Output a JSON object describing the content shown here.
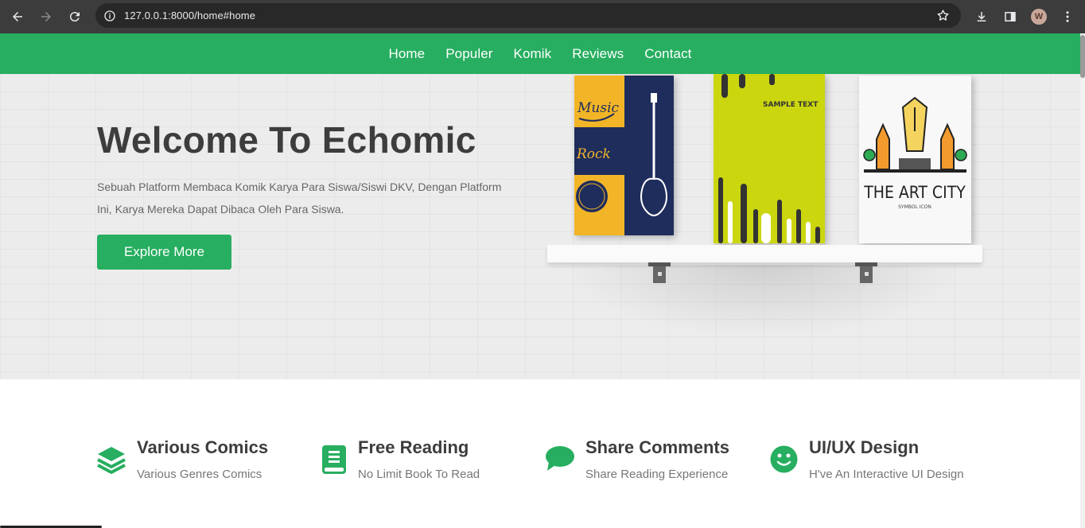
{
  "browser": {
    "url": "127.0.0.1:8000/home#home",
    "profile_initial": "W",
    "icons": [
      "back-icon",
      "forward-icon",
      "reload-icon",
      "info-icon",
      "star-icon",
      "download-icon",
      "side-panel-icon",
      "menu-dots-icon"
    ]
  },
  "navbar": {
    "links": [
      "Home",
      "Populer",
      "Komik",
      "Reviews",
      "Contact"
    ]
  },
  "hero": {
    "title": "Welcome To Echomic",
    "description": "Sebuah Platform Membaca Komik Karya Para Siswa/Siswi DKV, Dengan Platform Ini, Karya Mereka Dapat Dibaca Oleh Para Siswa.",
    "button": "Explore More",
    "books": [
      {
        "name": "music-rock-book",
        "texts": [
          "Music",
          "Rock"
        ]
      },
      {
        "name": "sample-text-book",
        "texts": [
          "SAMPLE TEXT"
        ]
      },
      {
        "name": "art-city-book",
        "texts": [
          "THE ART CITY",
          "SYMBOL ICON"
        ]
      }
    ]
  },
  "features": [
    {
      "icon": "layers-icon",
      "title": "Various Comics",
      "subtitle": "Various Genres Comics"
    },
    {
      "icon": "book-icon",
      "title": "Free Reading",
      "subtitle": "No Limit Book To Read"
    },
    {
      "icon": "comment-icon",
      "title": "Share Comments",
      "subtitle": "Share Reading Experience"
    },
    {
      "icon": "smile-icon",
      "title": "UI/UX Design",
      "subtitle": "H've An Interactive UI Design"
    }
  ],
  "colors": {
    "brand_green": "#27ae60",
    "chrome_dark": "#3c3c3c",
    "title_gray": "#3d3d3d"
  }
}
